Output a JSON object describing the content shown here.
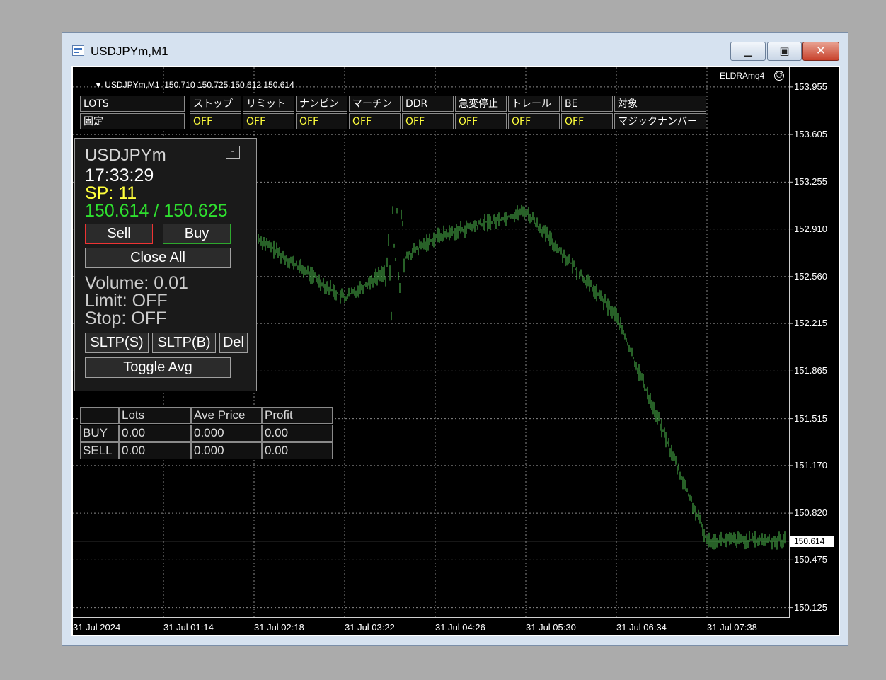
{
  "window": {
    "title": "USDJPYm,M1"
  },
  "chart_header": {
    "info": "USDJPYm,M1  150.710 150.725 150.612 150.614",
    "ea_name": "ELDRAmq4",
    "smiley_icon": "smiley-icon"
  },
  "price_axis": [
    "153.955",
    "153.605",
    "153.255",
    "152.910",
    "152.560",
    "152.215",
    "151.865",
    "151.515",
    "151.170",
    "150.820",
    "150.475",
    "150.125"
  ],
  "current_price": "150.614",
  "time_axis": [
    "31 Jul 2024",
    "31 Jul 01:14",
    "31 Jul 02:18",
    "31 Jul 03:22",
    "31 Jul 04:26",
    "31 Jul 05:30",
    "31 Jul 06:34",
    "31 Jul 07:38"
  ],
  "settings": [
    {
      "label": "LOTS",
      "value": "固定"
    },
    {
      "label": "ストップ",
      "value": "OFF"
    },
    {
      "label": "リミット",
      "value": "OFF"
    },
    {
      "label": "ナンピン",
      "value": "OFF"
    },
    {
      "label": "マーチン",
      "value": "OFF"
    },
    {
      "label": "DDR",
      "value": "OFF"
    },
    {
      "label": "急変停止",
      "value": "OFF"
    },
    {
      "label": "トレール",
      "value": "OFF"
    },
    {
      "label": "BE",
      "value": "OFF"
    },
    {
      "label": "対象",
      "value": "マジックナンバー"
    }
  ],
  "panel": {
    "symbol": "USDJPYm",
    "minimize": "-",
    "time": "17:33:29",
    "spread": "SP: 11",
    "bid_ask": "150.614 / 150.625",
    "sell": "Sell",
    "buy": "Buy",
    "close_all": "Close All",
    "volume": "Volume: 0.01",
    "limit": "Limit: OFF",
    "stop": "Stop: OFF",
    "sltp_s": "SLTP(S)",
    "sltp_b": "SLTP(B)",
    "del": "Del",
    "toggle_avg": "Toggle Avg"
  },
  "positions": {
    "headers": [
      "",
      "Lots",
      "Ave Price",
      "Profit"
    ],
    "rows": [
      [
        "BUY",
        "0.00",
        "0.000",
        "0.00"
      ],
      [
        "SELL",
        "0.00",
        "0.000",
        "0.00"
      ]
    ]
  },
  "colors": {
    "candle": "#4fc24f",
    "spread": "#ffff3c",
    "bidask": "#2fe02f",
    "grid": "#8a8a8a"
  },
  "chart_data": {
    "type": "line",
    "x": [
      "31 Jul 2024",
      "31 Jul 01:14",
      "31 Jul 02:18",
      "31 Jul 03:22",
      "31 Jul 04:26",
      "31 Jul 05:30",
      "31 Jul 06:34",
      "31 Jul 07:38"
    ],
    "series": [
      {
        "values": [
          152.72,
          152.88,
          152.86,
          152.4,
          152.85,
          153.04,
          152.27,
          150.62
        ]
      }
    ],
    "ylim": [
      150.05,
      154.1
    ],
    "grid": true
  }
}
